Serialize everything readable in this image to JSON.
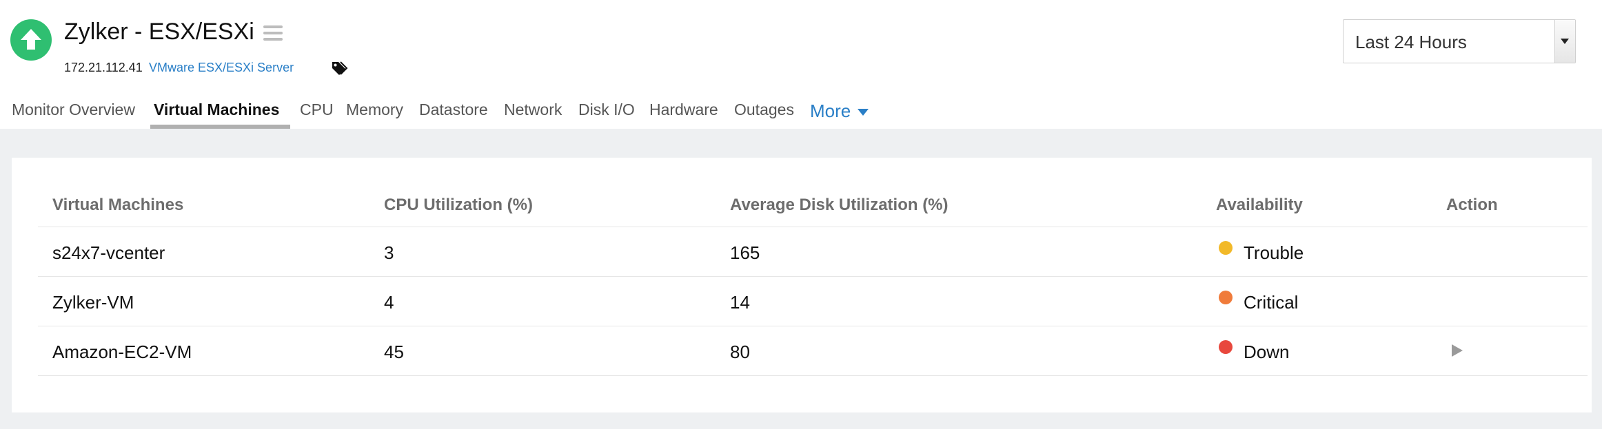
{
  "header": {
    "title": "Zylker - ESX/ESXi",
    "ip": "172.21.112.41",
    "server_type": "VMware ESX/ESXi Server",
    "status_color": "#2fbf71",
    "time_period": {
      "selected": "Last 24 Hours"
    }
  },
  "tabs": [
    {
      "label": "Monitor Overview",
      "active": false
    },
    {
      "label": "Virtual Machines",
      "active": true
    },
    {
      "label": "CPU",
      "active": false
    },
    {
      "label": "Memory",
      "active": false
    },
    {
      "label": "Datastore",
      "active": false
    },
    {
      "label": "Network",
      "active": false
    },
    {
      "label": "Disk I/O",
      "active": false
    },
    {
      "label": "Hardware",
      "active": false
    },
    {
      "label": "Outages",
      "active": false
    }
  ],
  "more_tab": {
    "label": "More"
  },
  "table": {
    "columns": [
      "Virtual Machines",
      "CPU Utilization (%)",
      "Average Disk Utilization (%)",
      "Availability",
      "Action"
    ],
    "rows": [
      {
        "name": "s24x7-vcenter",
        "cpu": "3",
        "disk": "165",
        "availability": "Trouble",
        "status_color": "#f2b929",
        "action": ""
      },
      {
        "name": "Zylker-VM",
        "cpu": "4",
        "disk": "14",
        "availability": "Critical",
        "status_color": "#f07b3a",
        "action": ""
      },
      {
        "name": "Amazon-EC2-VM",
        "cpu": "45",
        "disk": "80",
        "availability": "Down",
        "status_color": "#e8483d",
        "action": "play-icon"
      }
    ]
  }
}
